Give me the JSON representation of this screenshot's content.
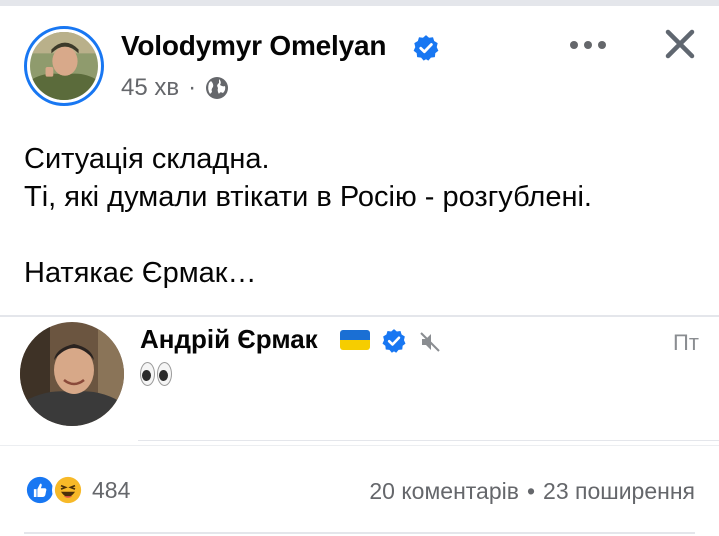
{
  "post": {
    "author": "Volodymyr Omelyan",
    "time": "45 хв",
    "separator": "·",
    "lines": [
      "Ситуація складна.",
      "Ті, які думали втікати в Росію - розгублені.",
      "Натякає Єрмак…"
    ]
  },
  "embedded": {
    "author": "Андрій Єрмак",
    "day": "Пт"
  },
  "footer": {
    "reaction_count": "484",
    "comments": "20 коментарів",
    "dot": "•",
    "shares": "23 поширення"
  },
  "icons": [
    "verified-icon",
    "globe-icon",
    "more-icon",
    "close-icon",
    "ukraine-flag-icon",
    "mute-icon",
    "eyes-emoji",
    "like-icon",
    "haha-icon"
  ],
  "colors": {
    "accent": "#1877f2",
    "secondary_text": "#65676b"
  }
}
